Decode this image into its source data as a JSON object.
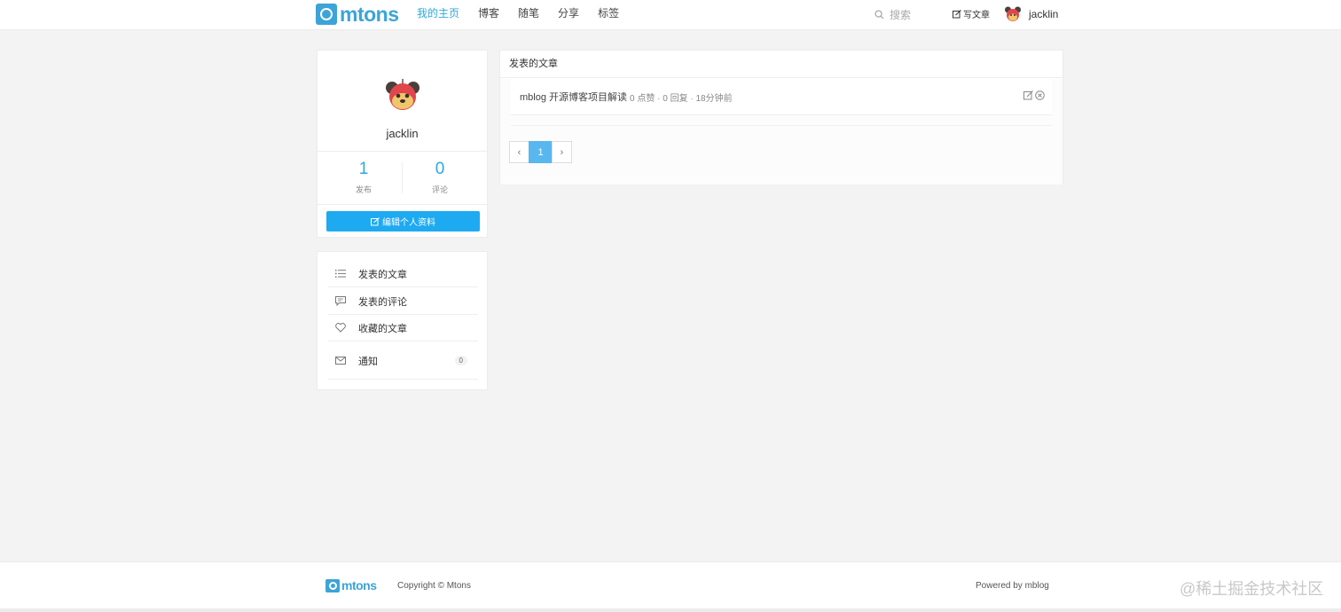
{
  "brand": {
    "name": "mtons",
    "color": "#3ca4d8"
  },
  "nav": {
    "items": [
      {
        "label": "我的主页",
        "active": true
      },
      {
        "label": "博客",
        "active": false
      },
      {
        "label": "随笔",
        "active": false
      },
      {
        "label": "分享",
        "active": false
      },
      {
        "label": "标签",
        "active": false
      }
    ],
    "search_placeholder": "搜索",
    "write_label": "写文章",
    "username": "jacklin",
    "accent": "#2ba9de"
  },
  "profile": {
    "name": "jacklin",
    "stats": [
      {
        "value": "1",
        "label": "发布"
      },
      {
        "value": "0",
        "label": "评论"
      }
    ],
    "edit_label": "编辑个人资料",
    "edit_color": "#1eaaf1"
  },
  "menu": {
    "items": [
      {
        "label": "发表的文章",
        "icon": "list-icon"
      },
      {
        "label": "发表的评论",
        "icon": "comment-icon"
      },
      {
        "label": "收藏的文章",
        "icon": "heart-icon"
      },
      {
        "label": "通知",
        "icon": "mail-icon",
        "badge": "0"
      }
    ]
  },
  "posts": {
    "heading": "发表的文章",
    "items": [
      {
        "title": "mblog 开源博客项目解读",
        "meta": "0 点赞 · 0 回复 · 18分钟前"
      }
    ],
    "pagination": {
      "prev": "‹",
      "current": "1",
      "next": "›"
    }
  },
  "footer": {
    "brand": "mtons",
    "copyright": "Copyright © Mtons",
    "powered_prefix": "Powered by",
    "powered_link": "mblog",
    "watermark": "@稀土掘金技术社区"
  }
}
